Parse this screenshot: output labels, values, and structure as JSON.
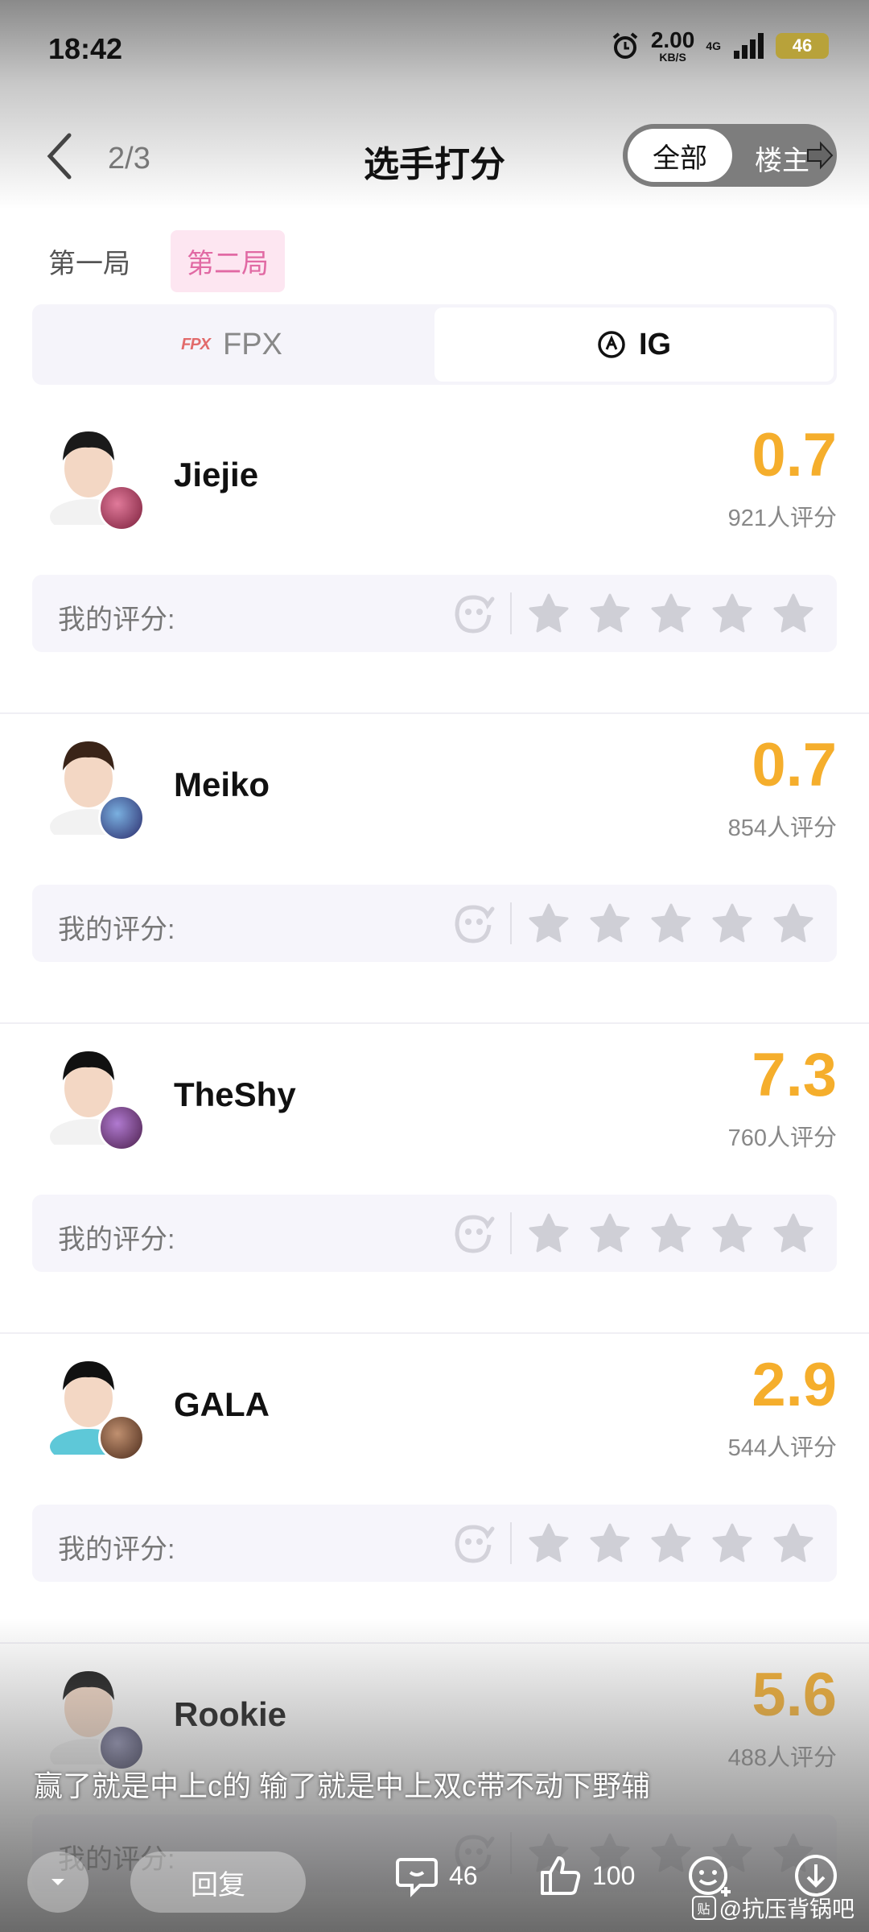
{
  "status_bar": {
    "time": "18:42",
    "speed_value": "2.00",
    "speed_unit": "KB/S",
    "network": "4G",
    "battery": "46"
  },
  "header": {
    "page_indicator": "2/3",
    "title": "选手打分",
    "toggle_all": "全部",
    "toggle_owner": "楼主"
  },
  "round_tabs": [
    "第一局",
    "第二局"
  ],
  "team_tabs": [
    {
      "logo_text": "FPX",
      "label": "FPX"
    },
    {
      "label": "IG"
    }
  ],
  "rating_label": "我的评分:",
  "players": [
    {
      "name": "Jiejie",
      "score": "0.7",
      "votes": "921人评分"
    },
    {
      "name": "Meiko",
      "score": "0.7",
      "votes": "854人评分"
    },
    {
      "name": "TheShy",
      "score": "7.3",
      "votes": "760人评分"
    },
    {
      "name": "GALA",
      "score": "2.9",
      "votes": "544人评分"
    },
    {
      "name": "Rookie",
      "score": "5.6",
      "votes": "488人评分"
    }
  ],
  "caption": "赢了就是中上c的 输了就是中上双c带不动下野辅",
  "bottom_bar": {
    "reply": "回复",
    "comments": "46",
    "likes": "100"
  },
  "watermark": {
    "badge": "贴",
    "text": "@抗压背锅吧"
  },
  "colors": {
    "score": "#f5ae2c",
    "active_round": "#e16aa4",
    "star": "#cfcfd6"
  },
  "icons": [
    "back-icon",
    "alarm-icon",
    "signal-icon",
    "ig-logo-icon",
    "rating-emoji-icon",
    "star-icon",
    "comment-icon",
    "like-icon",
    "emoji-add-icon",
    "download-icon",
    "chevron-down-icon",
    "toggle-arrow-icon"
  ]
}
